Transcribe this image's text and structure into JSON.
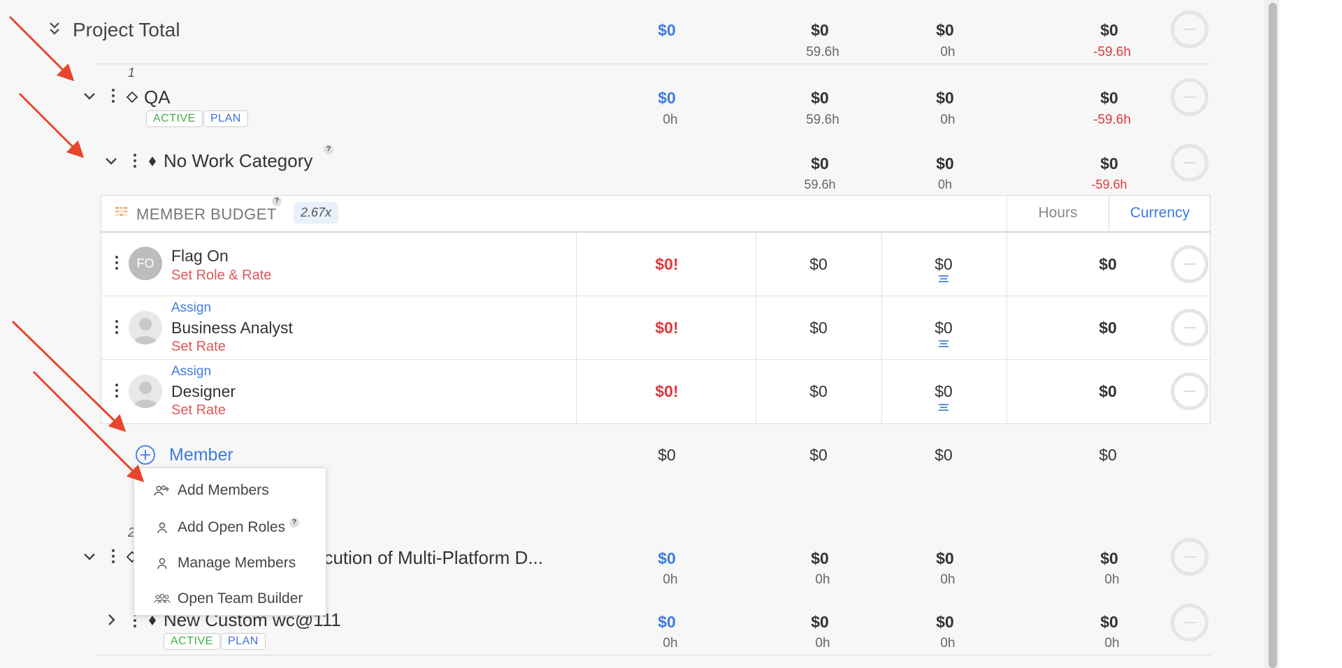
{
  "project_total": {
    "label": "Project Total",
    "col1": "$0",
    "col2": "$0",
    "col2_hours": "59.6h",
    "col3": "$0",
    "col3_hours": "0h",
    "col4": "$0",
    "col4_hours": "-59.6h"
  },
  "phase_qa": {
    "number": "1",
    "name": "QA",
    "tags": [
      "ACTIVE",
      "PLAN"
    ],
    "col1": "$0",
    "col1_hours": "0h",
    "col2": "$0",
    "col2_hours": "59.6h",
    "col3": "$0",
    "col3_hours": "0h",
    "col4": "$0",
    "col4_hours": "-59.6h"
  },
  "work_category": {
    "name": "No Work Category",
    "help": "?",
    "col2": "$0",
    "col2_hours": "59.6h",
    "col3": "$0",
    "col3_hours": "0h",
    "col4": "$0",
    "col4_hours": "-59.6h"
  },
  "member_budget": {
    "title": "MEMBER BUDGET",
    "help": "?",
    "multiplier": "2.67x",
    "toggle_hours": "Hours",
    "toggle_currency": "Currency",
    "rows": [
      {
        "initials": "FO",
        "assign": "",
        "name": "Flag On",
        "action": "Set Role & Rate",
        "c1": "$0!",
        "c2": "$0",
        "c3": "$0",
        "c4": "$0"
      },
      {
        "initials": "",
        "assign": "Assign",
        "name": "Business Analyst",
        "action": "Set Rate",
        "c1": "$0!",
        "c2": "$0",
        "c3": "$0",
        "c4": "$0"
      },
      {
        "initials": "",
        "assign": "Assign",
        "name": "Designer",
        "action": "Set Rate",
        "c1": "$0!",
        "c2": "$0",
        "c3": "$0",
        "c4": "$0"
      }
    ]
  },
  "member_add": {
    "label": "Member",
    "c1": "$0",
    "c2": "$0",
    "c3": "$0",
    "c4": "$0"
  },
  "dropdown_menu": {
    "items": [
      "Add Members",
      "Add Open Roles",
      "Manage Members",
      "Open Team Builder"
    ],
    "open_roles_help": "?"
  },
  "phase_2": {
    "number": "2",
    "name_visible": "ecution of Multi-Platform D...",
    "col1": "$0",
    "col1_hours": "0h",
    "col2": "$0",
    "col2_hours": "0h",
    "col3": "$0",
    "col3_hours": "0h",
    "col4": "$0",
    "col4_hours": "0h"
  },
  "custom_wc": {
    "name": "New Custom wc@111",
    "tags": [
      "ACTIVE",
      "PLAN"
    ],
    "col1": "$0",
    "col1_hours": "0h",
    "col2": "$0",
    "col2_hours": "0h",
    "col3": "$0",
    "col3_hours": "0h",
    "col4": "$0",
    "col4_hours": "0h"
  },
  "colors": {
    "accent_blue": "#3d7be0",
    "warning_red": "#e0383e",
    "active_green": "#3fae45",
    "annotation_arrow": "#e8452c"
  }
}
